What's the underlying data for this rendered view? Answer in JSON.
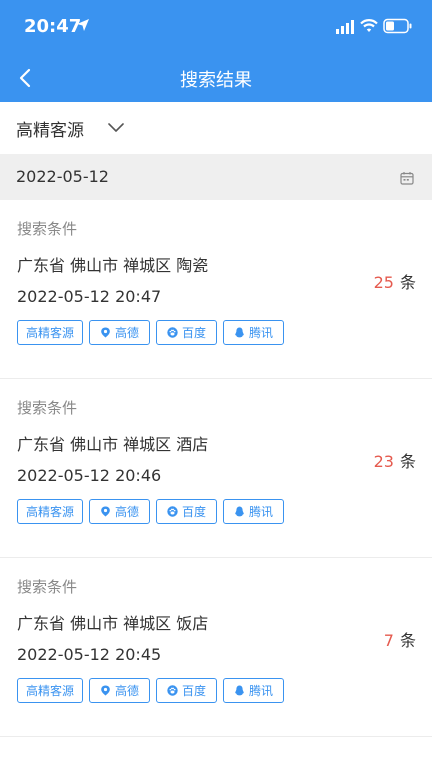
{
  "status_bar": {
    "time": "20:47",
    "icons": [
      "location-arrow-icon",
      "signal-icon",
      "wifi-icon",
      "battery-icon"
    ]
  },
  "nav": {
    "title": "搜索结果",
    "back_icon": "chevron-left-icon"
  },
  "filter": {
    "selected": "高精客源",
    "icon": "chevron-down-icon"
  },
  "date_filter": {
    "value": "2022-05-12",
    "icon": "calendar-icon"
  },
  "records": [
    {
      "label": "搜索条件",
      "condition": "广东省 佛山市 禅城区 陶瓷",
      "time": "2022-05-12 20:47",
      "count": "25",
      "unit": "条",
      "tags": [
        "高精客源",
        "高德",
        "百度",
        "腾讯"
      ]
    },
    {
      "label": "搜索条件",
      "condition": "广东省 佛山市 禅城区 酒店",
      "time": "2022-05-12 20:46",
      "count": "23",
      "unit": "条",
      "tags": [
        "高精客源",
        "高德",
        "百度",
        "腾讯"
      ]
    },
    {
      "label": "搜索条件",
      "condition": "广东省 佛山市 禅城区 饭店",
      "time": "2022-05-12 20:45",
      "count": "7",
      "unit": "条",
      "tags": [
        "高精客源",
        "高德",
        "百度",
        "腾讯"
      ]
    }
  ],
  "colors": {
    "primary": "#3a93f0",
    "count": "#e55a4e",
    "datebar_bg": "#efefef"
  }
}
